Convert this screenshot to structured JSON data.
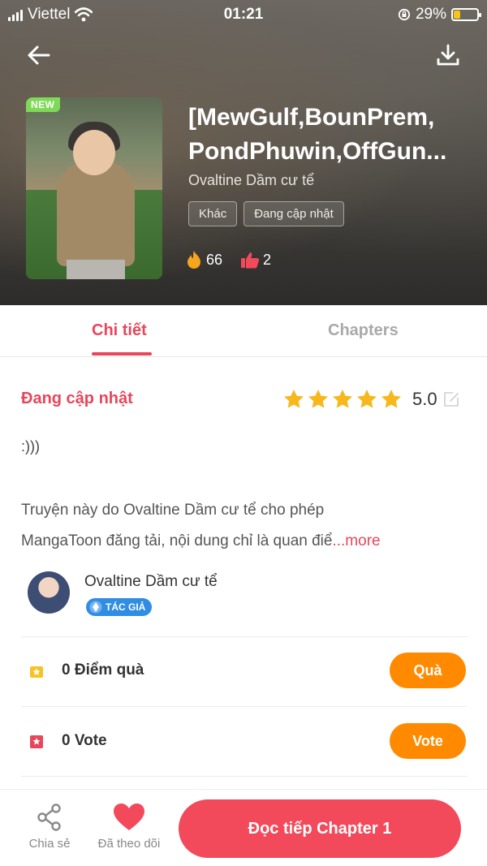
{
  "status_bar": {
    "carrier": "Viettel",
    "time": "01:21",
    "battery": "29%",
    "battery_level": 0.29
  },
  "header": {
    "badge": "NEW",
    "title_line1": "[MewGulf,BounPrem,",
    "title_line2": "PondPhuwin,OffGun...",
    "author": "Ovaltine Dầm cư tể",
    "tags": [
      "Khác",
      "Đang cập nhật"
    ],
    "likes": "66",
    "thumbs": "2"
  },
  "tabs": {
    "detail": "Chi tiết",
    "chapters": "Chapters"
  },
  "detail": {
    "status": "Đang cập nhật",
    "rating": "5.0",
    "stars": 5,
    "short_text": ":)))",
    "desc_line1": "Truyện này do Ovaltine Dầm cư tể cho phép",
    "desc_line2": "MangaToon đăng tải, nội dung chỉ là quan điể",
    "more": "...more"
  },
  "author": {
    "name": "Ovaltine Dầm cư tể",
    "badge": "TÁC GIẢ"
  },
  "gift": {
    "label": "0 Điểm quà",
    "button": "Quà"
  },
  "vote": {
    "label": "0 Vote",
    "button": "Vote"
  },
  "bottom": {
    "share": "Chia sẻ",
    "follow": "Đã theo dõi",
    "read": "Đọc tiếp Chapter 1"
  },
  "colors": {
    "accent": "#e8465a",
    "orange": "#ff8a00",
    "new_badge": "#7ed957",
    "star": "#f6b81c"
  }
}
